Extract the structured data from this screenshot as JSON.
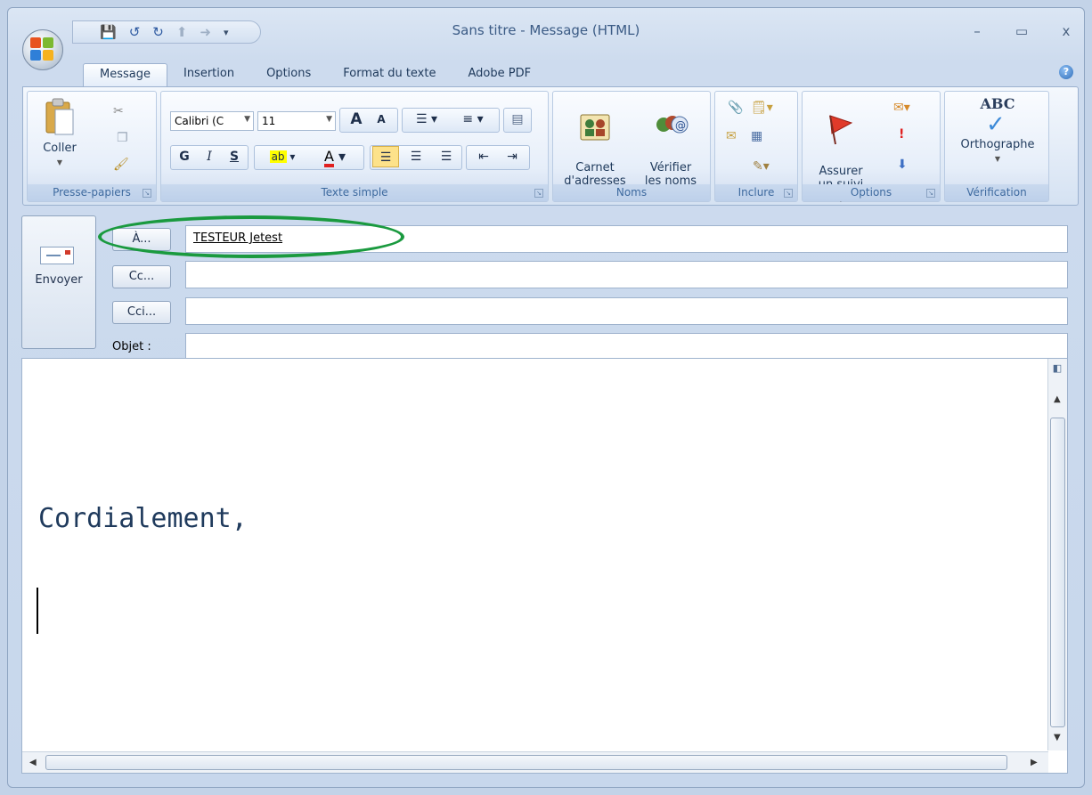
{
  "window": {
    "title": "Sans titre - Message (HTML)"
  },
  "quick_access": {
    "icons": [
      "save-icon",
      "undo-icon",
      "redo-icon",
      "up-arrow-icon",
      "down-arrow-icon",
      "customize-dropdown-icon"
    ]
  },
  "window_controls": {
    "minimize": "–",
    "maximize": "▭",
    "close": "x"
  },
  "tabs": [
    {
      "label": "Message",
      "active": true
    },
    {
      "label": "Insertion",
      "active": false
    },
    {
      "label": "Options",
      "active": false
    },
    {
      "label": "Format du texte",
      "active": false
    },
    {
      "label": "Adobe PDF",
      "active": false
    }
  ],
  "ribbon": {
    "clipboard": {
      "label": "Presse-papiers",
      "paste": "Coller"
    },
    "basic_text": {
      "label": "Texte simple",
      "font_name": "Calibri (C",
      "font_size": "11",
      "bold": "G",
      "italic": "I",
      "underline": "S",
      "grow": "A",
      "shrink": "A"
    },
    "names": {
      "label": "Noms",
      "address_book": "Carnet\nd'adresses",
      "check_names": "Vérifier\nles noms"
    },
    "include": {
      "label": "Inclure"
    },
    "options": {
      "label": "Options",
      "follow_up": "Assurer\nun suivi"
    },
    "proofing": {
      "label": "Vérification",
      "spelling": "Orthographe",
      "abc": "ABC"
    }
  },
  "compose": {
    "send_label": "Envoyer",
    "to_button": "À...",
    "cc_button": "Cc...",
    "bcc_button": "Cci...",
    "subject_label": "Objet :",
    "to_value": "TESTEUR Jetest",
    "cc_value": "",
    "bcc_value": "",
    "subject_value": ""
  },
  "body": {
    "text": "Cordialement,"
  },
  "colors": {
    "highlight_ellipse": "#1a9a3f",
    "ribbon_text": "#1e395b",
    "body_text": "#1f3a5c"
  }
}
